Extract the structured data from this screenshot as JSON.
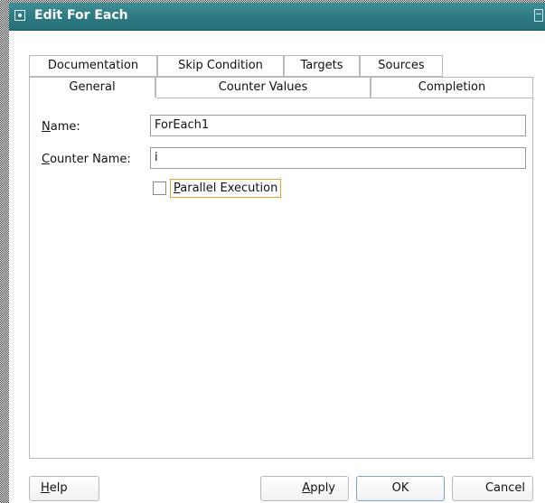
{
  "dialog": {
    "title": "Edit For Each"
  },
  "tabs": {
    "row1": [
      {
        "label": "Documentation"
      },
      {
        "label": "Skip Condition"
      },
      {
        "label": "Targets"
      },
      {
        "label": "Sources"
      }
    ],
    "row2": [
      {
        "label": "General",
        "selected": true
      },
      {
        "label": "Counter Values",
        "selected": false
      },
      {
        "label": "Completion",
        "selected": false
      }
    ]
  },
  "general": {
    "name_label_mnemonic": "N",
    "name_label_rest": "ame:",
    "name_value": "ForEach1",
    "counter_label_mnemonic": "C",
    "counter_label_rest": "ounter Name:",
    "counter_value": "i",
    "parallel_mnemonic": "P",
    "parallel_rest": "arallel Execution",
    "parallel_checked": false
  },
  "buttons": {
    "help_mnemonic": "H",
    "help_rest": "elp",
    "apply_mnemonic": "A",
    "apply_rest": "pply",
    "ok_label": "OK",
    "cancel_label": "Cancel"
  },
  "colors": {
    "titlebar": "#2c7780",
    "focus_border": "#f0a030",
    "default_button_border": "#7ba6c9"
  },
  "icons": {
    "title_icon": "dialog-radio-icon",
    "maximize_icon": "maximize-icon"
  }
}
